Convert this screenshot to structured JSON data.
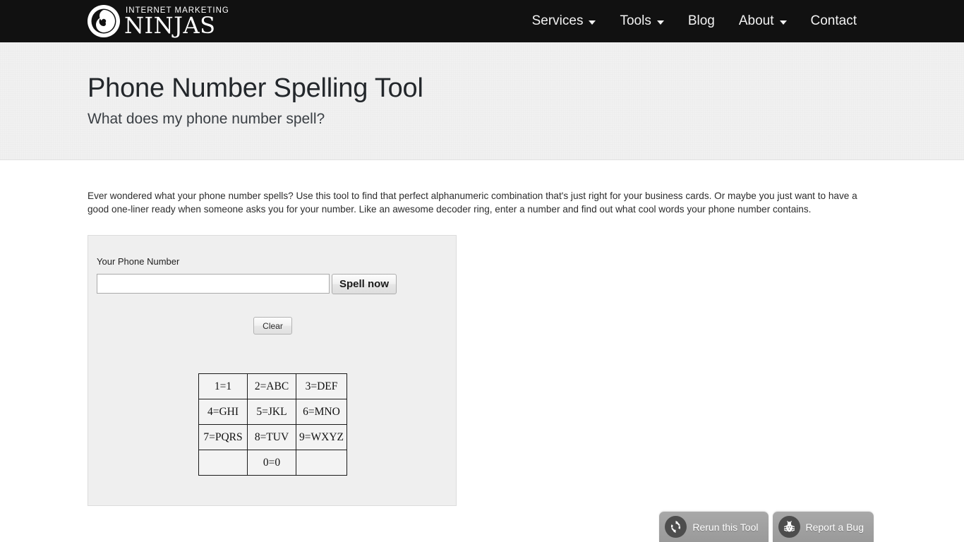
{
  "header": {
    "logo": {
      "icon": "ninjas-swirl-logo-icon",
      "top_text": "INTERNET MARKETING",
      "bottom_text": "NINJAS"
    },
    "nav": [
      {
        "label": "Services",
        "has_dropdown": true
      },
      {
        "label": "Tools",
        "has_dropdown": true
      },
      {
        "label": "Blog",
        "has_dropdown": false
      },
      {
        "label": "About",
        "has_dropdown": true
      },
      {
        "label": "Contact",
        "has_dropdown": false
      }
    ],
    "background_color": "#111111"
  },
  "hero": {
    "title": "Phone Number Spelling Tool",
    "subtitle": "What does my phone number spell?",
    "background_color": "#f1f1f1"
  },
  "main": {
    "intro_paragraph": "Ever wondered what your phone number spells? Use this tool to find that perfect alphanumeric combination that's just right for your business cards. Or maybe you just want to have a good one-liner ready when someone asks you for your number. Like an awesome decoder ring, enter a number and find out what cool words your phone number contains.",
    "form": {
      "field_label": "Your Phone Number",
      "phone_value": "",
      "phone_placeholder": "",
      "submit_label": "Spell now",
      "clear_label": "Clear"
    },
    "keypad": {
      "rows": [
        [
          "1=1",
          "2=ABC",
          "3=DEF"
        ],
        [
          "4=GHI",
          "5=JKL",
          "6=MNO"
        ],
        [
          "7=PQRS",
          "8=TUV",
          "9=WXYZ"
        ],
        [
          "",
          "0=0",
          ""
        ]
      ]
    }
  },
  "footer_buttons": [
    {
      "label": "Rerun this Tool",
      "icon": "refresh-icon"
    },
    {
      "label": "Report a Bug",
      "icon": "bug-icon"
    }
  ]
}
